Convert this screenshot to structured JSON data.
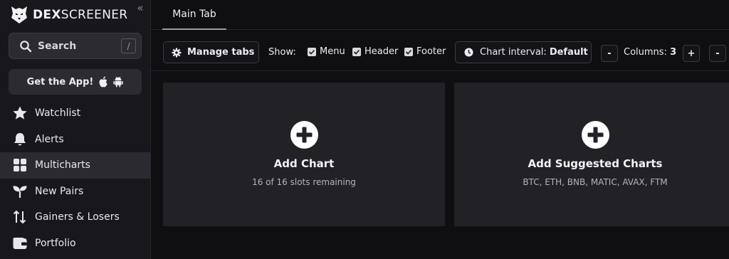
{
  "sidebar": {
    "logo": {
      "part1": "DEX",
      "part2": "SCREENER"
    },
    "collapse_glyph": "«",
    "search": {
      "label": "Search",
      "shortcut": "/"
    },
    "get_app": {
      "label": "Get the App!"
    },
    "items": [
      {
        "label": "Watchlist",
        "icon": "star-icon"
      },
      {
        "label": "Alerts",
        "icon": "bell-icon"
      },
      {
        "label": "Multicharts",
        "icon": "grid-icon",
        "active": true
      },
      {
        "label": "New Pairs",
        "icon": "sprout-icon"
      },
      {
        "label": "Gainers & Losers",
        "icon": "arrows-updown-icon"
      },
      {
        "label": "Portfolio",
        "icon": "wallet-icon"
      }
    ]
  },
  "tabs": [
    {
      "label": "Main Tab",
      "active": true
    }
  ],
  "toolbar": {
    "manage_tabs": "Manage tabs",
    "show_label": "Show:",
    "checkboxes": [
      {
        "label": "Menu",
        "checked": true
      },
      {
        "label": "Header",
        "checked": true
      },
      {
        "label": "Footer",
        "checked": true
      }
    ],
    "interval_label": "Chart interval:",
    "interval_value": "Default",
    "minus": "-",
    "plus": "+",
    "columns_label": "Columns:",
    "columns_value": "3"
  },
  "cards": {
    "add_chart": {
      "title": "Add Chart",
      "subtitle": "16 of 16 slots remaining"
    },
    "add_suggested": {
      "title": "Add Suggested Charts",
      "subtitle": "BTC, ETH, BNB, MATIC, AVAX, FTM"
    }
  },
  "colors": {
    "background": "#0f0f12",
    "sidebar": "#18181c",
    "card": "#212126",
    "accent": "#ffffff"
  }
}
